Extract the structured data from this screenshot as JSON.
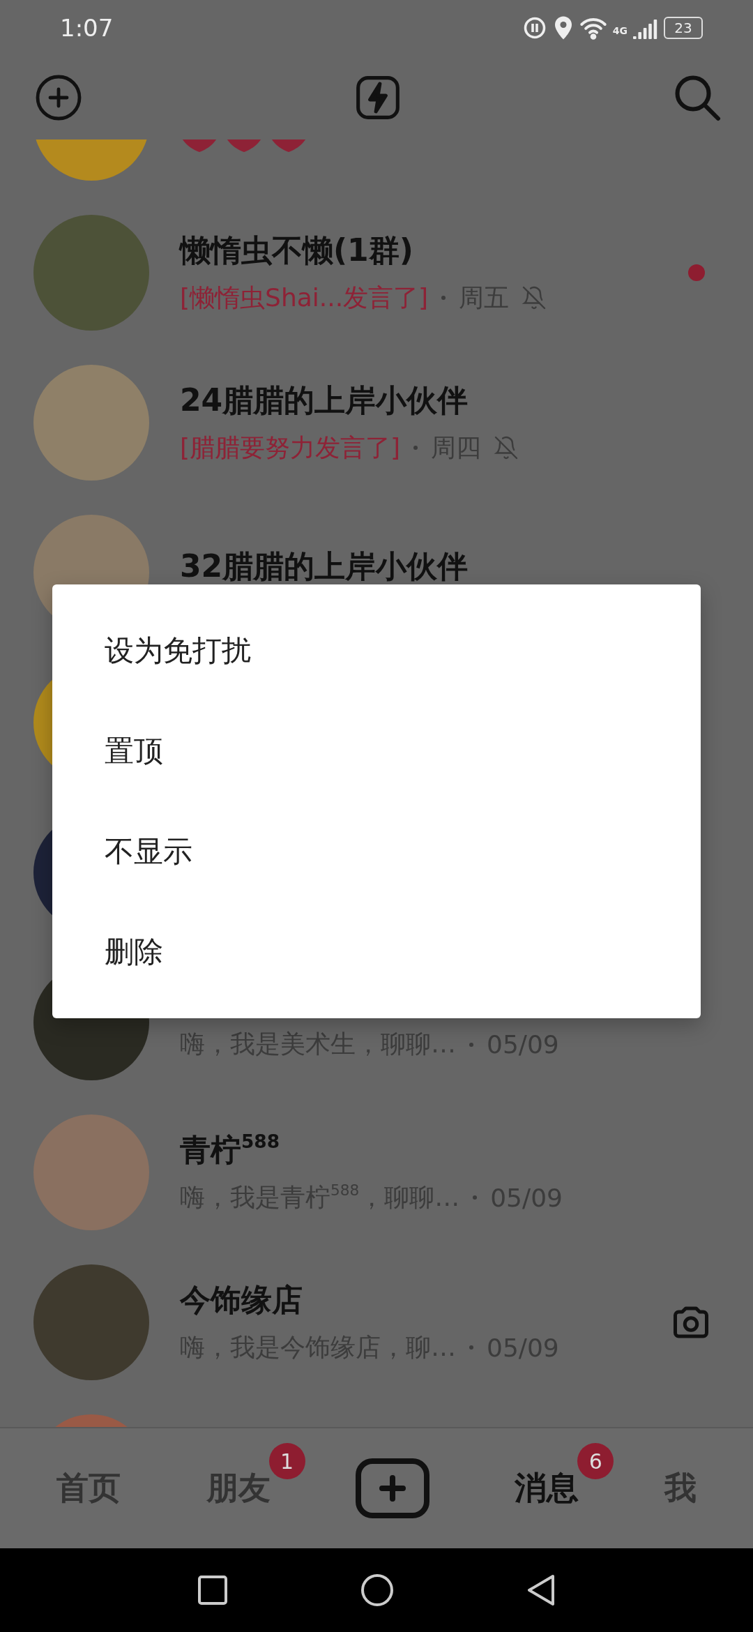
{
  "status_bar": {
    "time": "1:07",
    "network": "4G",
    "battery": "23"
  },
  "rows": [
    {
      "kind": "hearts"
    },
    {
      "kind": "full",
      "title": "懒惰虫不懒(1群)",
      "mention": "[懒惰虫Shai...发言了]",
      "time": "周五",
      "muted": true,
      "unread": true,
      "camera": false
    },
    {
      "kind": "full",
      "title": "24腊腊的上岸小伙伴",
      "mention": "[腊腊要努力发言了]",
      "time": "周四",
      "muted": true,
      "unread": false,
      "camera": false
    },
    {
      "kind": "title_only",
      "title": "32腊腊的上岸小伙伴"
    },
    {
      "kind": "avatar"
    },
    {
      "kind": "avatar"
    },
    {
      "kind": "full",
      "preview": "嗨，我是美术生，聊聊…",
      "time": "05/09",
      "muted": false,
      "unread": false,
      "camera": false
    },
    {
      "kind": "full",
      "title": "青柠$^{588}$",
      "preview": "嗨，我是青柠$^{588}$，聊聊…",
      "time": "05/09",
      "muted": false,
      "unread": false,
      "camera": false
    },
    {
      "kind": "full",
      "title": "今饰缘店",
      "preview": "嗨，我是今饰缘店，聊…",
      "time": "05/09",
      "muted": false,
      "unread": false,
      "camera": true
    },
    {
      "kind": "avatar"
    }
  ],
  "menu": [
    "设为免打扰",
    "置顶",
    "不显示",
    "删除"
  ],
  "tabs": [
    {
      "kind": "text",
      "label": "首页",
      "selected": false
    },
    {
      "kind": "text",
      "label": "朋友",
      "badge": "1",
      "selected": false
    },
    {
      "kind": "plus"
    },
    {
      "kind": "text",
      "label": "消息",
      "badge": "6",
      "selected": true
    },
    {
      "kind": "text",
      "label": "我",
      "selected": false
    }
  ]
}
